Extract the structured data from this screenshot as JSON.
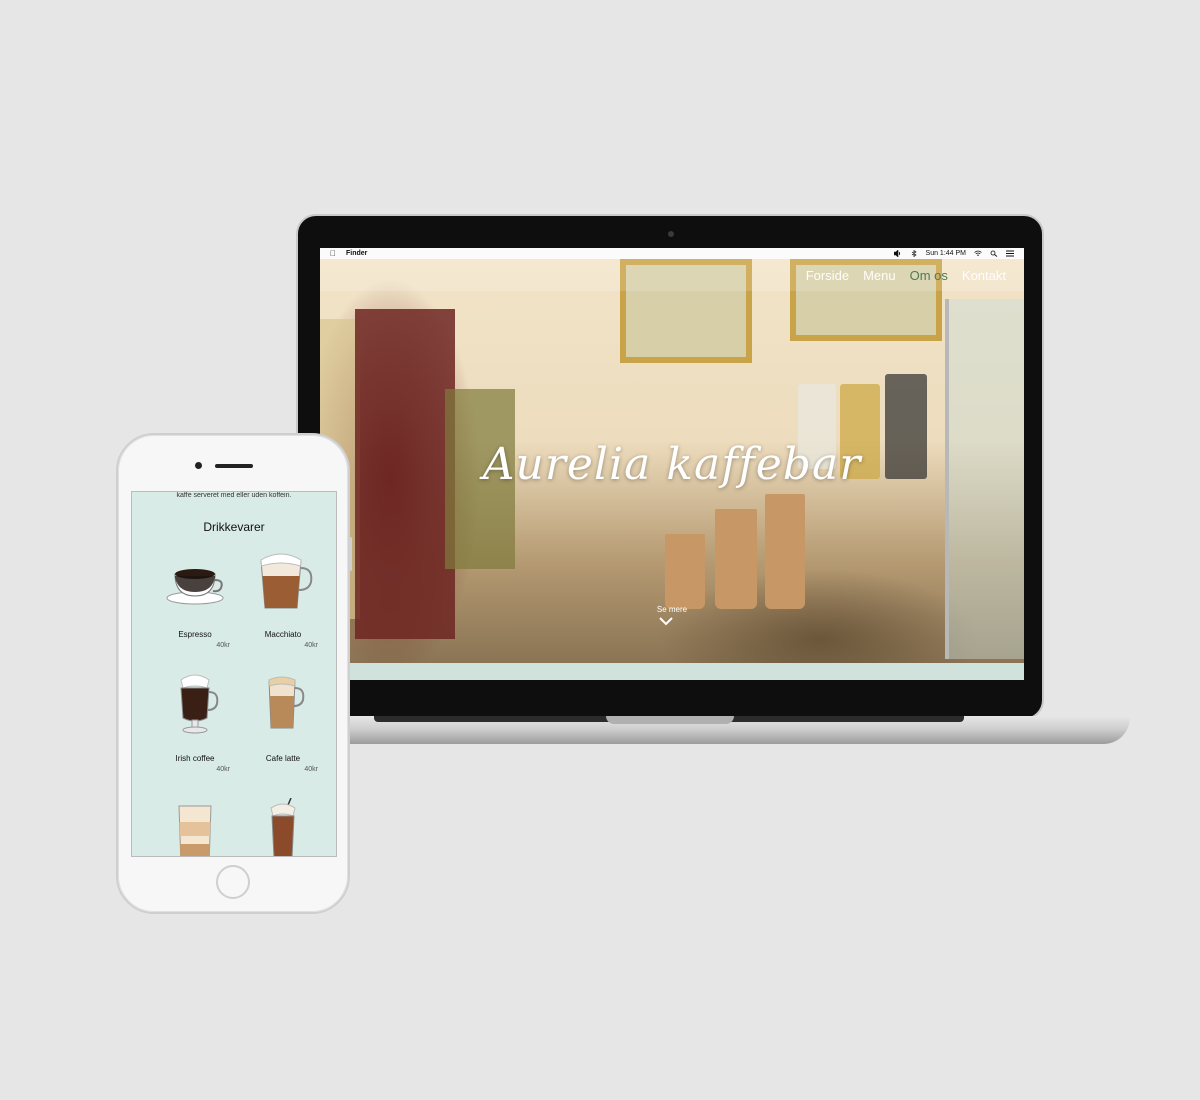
{
  "laptop": {
    "menubar": {
      "app_name": "Finder",
      "clock": "Sun 1:44 PM",
      "icons": [
        "apple-icon",
        "volume-icon",
        "bluetooth-icon",
        "wifi-icon",
        "search-icon",
        "list-icon"
      ]
    },
    "nav": {
      "items": [
        {
          "label": "Forside",
          "active": false
        },
        {
          "label": "Menu",
          "active": false
        },
        {
          "label": "Om os",
          "active": true
        },
        {
          "label": "Kontakt",
          "active": false
        }
      ]
    },
    "hero": {
      "title": "Aurelia kaffebar",
      "see_more": "Se mere"
    }
  },
  "phone": {
    "intro_text": "kaffe serveret med eller uden koffein.",
    "section_title": "Drikkevarer",
    "drinks": [
      {
        "name": "Espresso",
        "price": "40kr"
      },
      {
        "name": "Macchiato",
        "price": "40kr"
      },
      {
        "name": "Irish coffee",
        "price": "40kr"
      },
      {
        "name": "Cafe latte",
        "price": "40kr"
      }
    ]
  },
  "colors": {
    "background": "#e6e6e6",
    "mint": "#d9ebe6",
    "nav_active": "#4e7a58",
    "title": "#ffffff"
  }
}
